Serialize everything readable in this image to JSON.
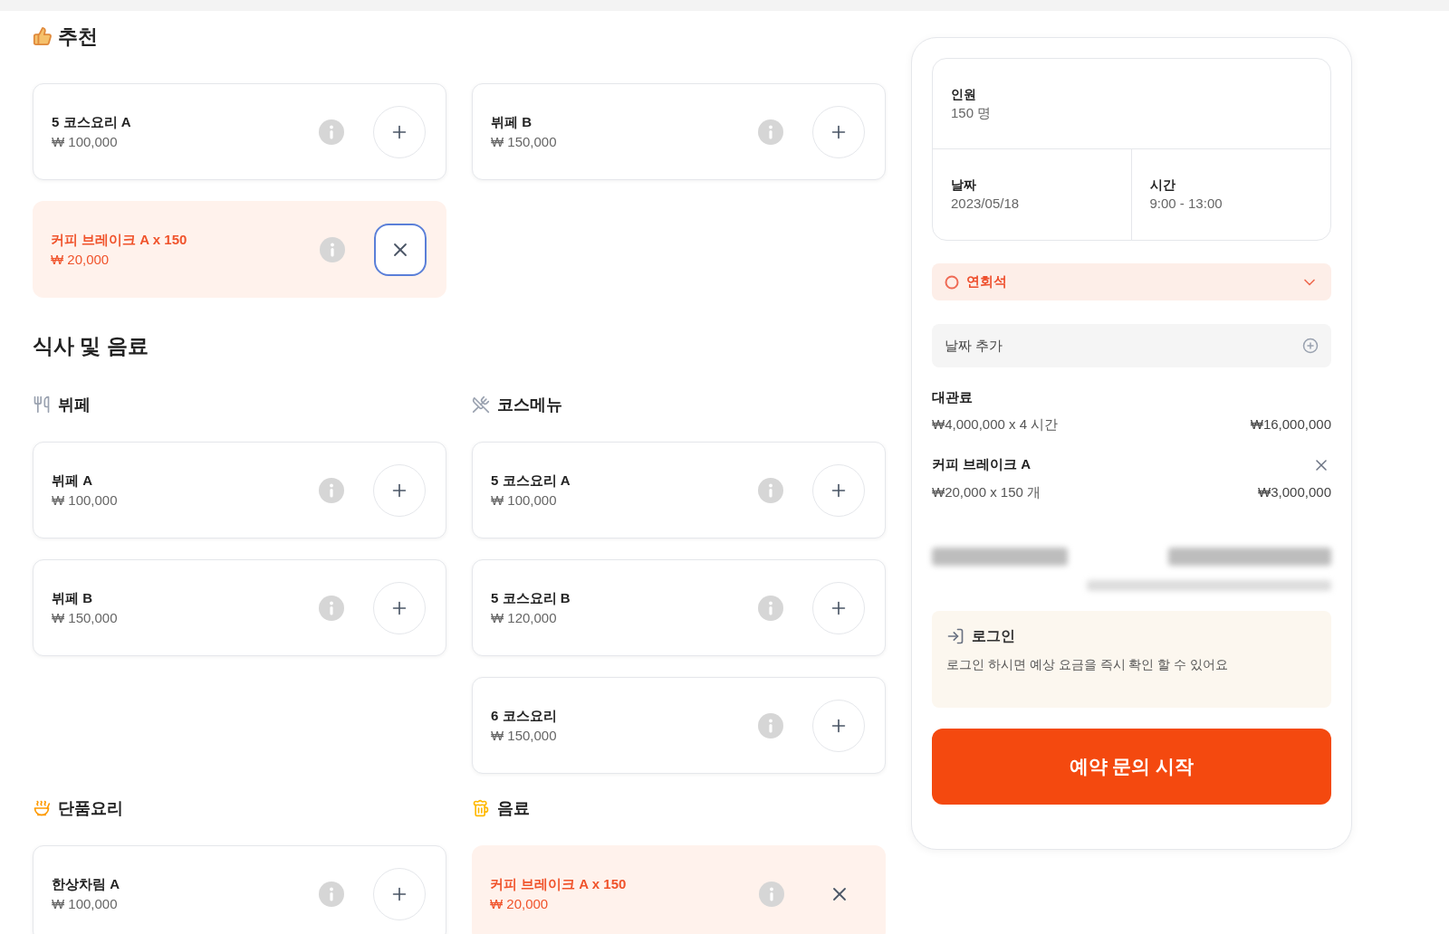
{
  "recommended": {
    "title": "추천",
    "items": [
      {
        "name": "5 코스요리 A",
        "price": "₩ 100,000",
        "selected": false,
        "focused": false
      },
      {
        "name": "뷔페 B",
        "price": "₩ 150,000",
        "selected": false,
        "focused": false
      },
      {
        "name": "커피 브레이크 A x 150",
        "price": "₩ 20,000",
        "selected": true,
        "focused": true
      }
    ]
  },
  "menu": {
    "title": "식사 및 음료",
    "groups": [
      {
        "title": "뷔페",
        "items": [
          {
            "name": "뷔페 A",
            "price": "₩ 100,000",
            "selected": false,
            "focused": false
          },
          {
            "name": "뷔페 B",
            "price": "₩ 150,000",
            "selected": false,
            "focused": false
          }
        ]
      },
      {
        "title": "코스메뉴",
        "items": [
          {
            "name": "5 코스요리 A",
            "price": "₩ 100,000",
            "selected": false,
            "focused": false
          },
          {
            "name": "5 코스요리 B",
            "price": "₩ 120,000",
            "selected": false,
            "focused": false
          },
          {
            "name": "6 코스요리",
            "price": "₩ 150,000",
            "selected": false,
            "focused": false
          }
        ]
      },
      {
        "title": "단품요리",
        "items": [
          {
            "name": "한상차림 A",
            "price": "₩ 100,000",
            "selected": false,
            "focused": false
          }
        ]
      },
      {
        "title": "음료",
        "items": [
          {
            "name": "커피 브레이크 A x 150",
            "price": "₩ 20,000",
            "selected": true,
            "focused": false
          }
        ]
      }
    ]
  },
  "booking": {
    "guests": {
      "label": "인원",
      "value": "150 명"
    },
    "date": {
      "label": "날짜",
      "value": "2023/05/18"
    },
    "time": {
      "label": "시간",
      "value": "9:00 - 13:00"
    },
    "room_select": {
      "value": "연회석"
    },
    "add_date_button": "날짜 추가",
    "charges": [
      {
        "name": "대관료",
        "detail": "₩4,000,000 x 4 시간",
        "amount": "₩16,000,000",
        "removable": false
      },
      {
        "name": "커피 브레이크 A",
        "detail": "₩20,000 x 150 개",
        "amount": "₩3,000,000",
        "removable": true
      }
    ],
    "login_notice": {
      "title": "로그인",
      "text": "로그인 하시면 예상 요금을 즉시 확인 할 수 있어요"
    },
    "submit_button": "예약 문의 시작"
  }
}
